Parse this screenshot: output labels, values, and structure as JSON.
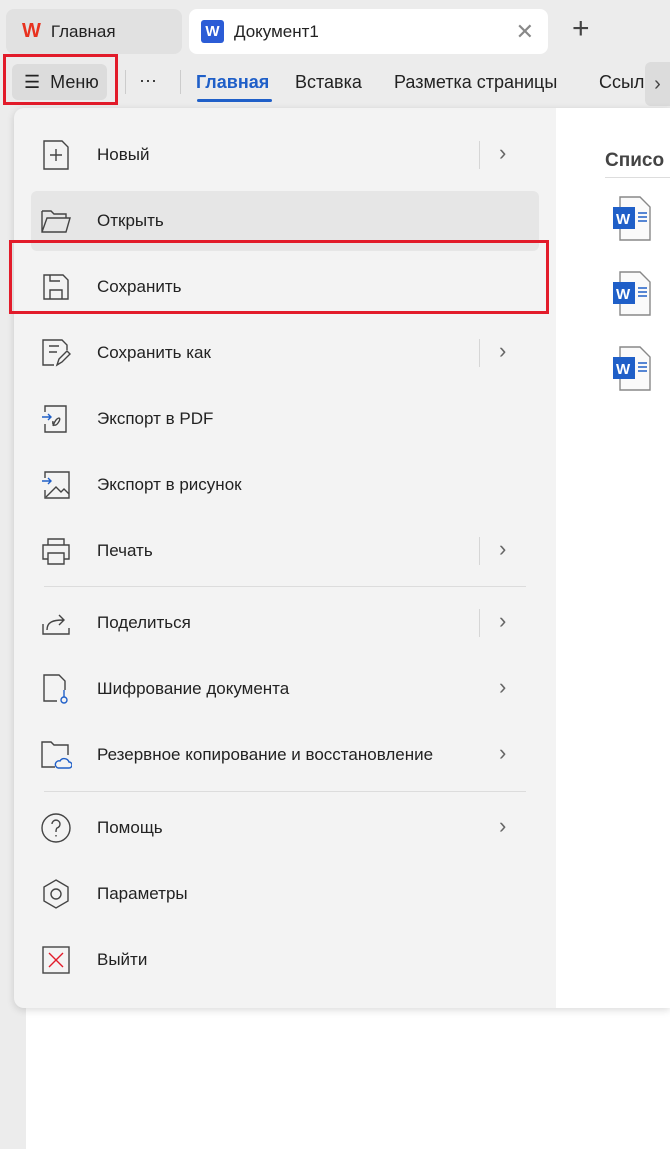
{
  "tabs": [
    {
      "label": "Главная",
      "icon": "wps-logo-icon"
    },
    {
      "label": "Документ1",
      "icon": "word-doc-icon"
    }
  ],
  "new_tab_label": "+",
  "toolbar": {
    "menu_label": "Меню",
    "more_label": "···",
    "tabs": [
      "Главная",
      "Вставка",
      "Разметка страницы",
      "Ссыл"
    ],
    "active_tab": "Главная"
  },
  "menu": {
    "items": [
      {
        "label": "Новый",
        "icon": "new-file-icon"
      },
      {
        "label": "Открыть",
        "icon": "folder-open-icon"
      },
      {
        "label": "Сохранить",
        "icon": "save-icon"
      },
      {
        "label": "Сохранить как",
        "icon": "save-as-icon"
      },
      {
        "label": "Экспорт в PDF",
        "icon": "export-pdf-icon"
      },
      {
        "label": "Экспорт в рисунок",
        "icon": "export-image-icon"
      },
      {
        "label": "Печать",
        "icon": "print-icon"
      },
      {
        "label": "Поделиться",
        "icon": "share-icon"
      },
      {
        "label": "Шифрование документа",
        "icon": "encrypt-icon"
      },
      {
        "label": "Резервное копирование и восстановление",
        "icon": "backup-icon"
      },
      {
        "label": "Помощь",
        "icon": "help-icon"
      },
      {
        "label": "Параметры",
        "icon": "settings-icon"
      },
      {
        "label": "Выйти",
        "icon": "exit-icon"
      }
    ]
  },
  "recent": {
    "title": "Списо"
  },
  "colors": {
    "accent": "#1f5fc8",
    "highlight": "#e21b2a"
  }
}
